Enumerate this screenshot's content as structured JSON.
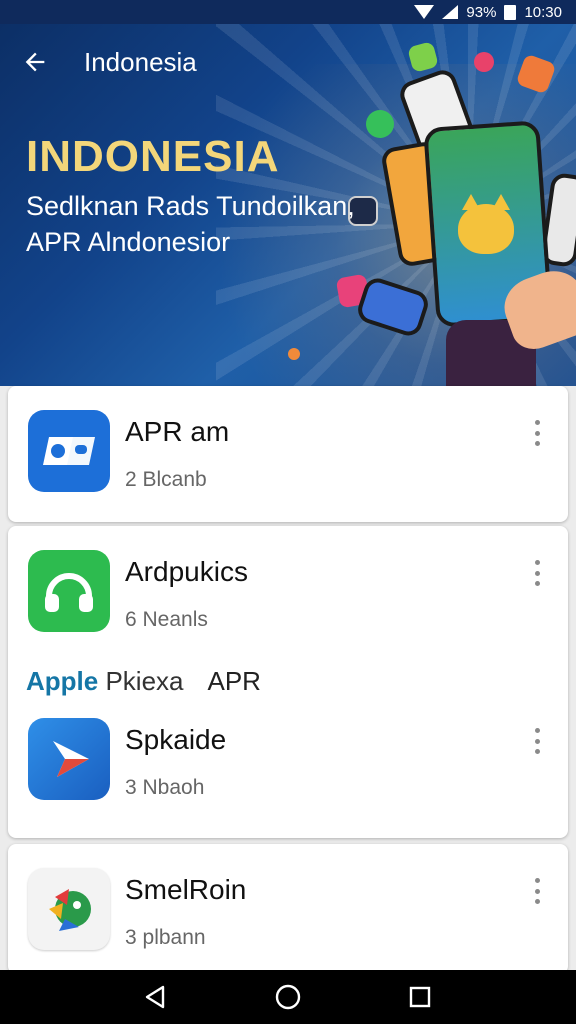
{
  "status_bar": {
    "battery": "93%",
    "time": "10:30"
  },
  "app_bar": {
    "title": "Indonesia"
  },
  "hero": {
    "title": "INDONESIA",
    "subtitle_line1": "Sedlknan Rads Tundoilkan,",
    "subtitle_line2": "APR Alndonesior"
  },
  "apps": [
    {
      "name": "APR am",
      "meta": "2 Blcanb",
      "icon": "app-logo-icon",
      "color": "#1d6fd8"
    },
    {
      "name": "Ardpukics",
      "meta": "6 Neanls",
      "icon": "headphones-icon",
      "color": "#2dbb4f"
    },
    {
      "name": "Spkaide",
      "meta": "3 Nbaoh",
      "icon": "play-arrow-icon",
      "color": "#1f72d6"
    },
    {
      "name": "SmelRoin",
      "meta": "3 plbann",
      "icon": "parrot-icon",
      "color": "#f3f3f3"
    }
  ],
  "section": {
    "accent": "Apple",
    "middle": " Pkiexa",
    "tail": "APR"
  },
  "nav": {
    "back": "back-icon",
    "home": "home-icon",
    "recents": "recents-icon"
  }
}
